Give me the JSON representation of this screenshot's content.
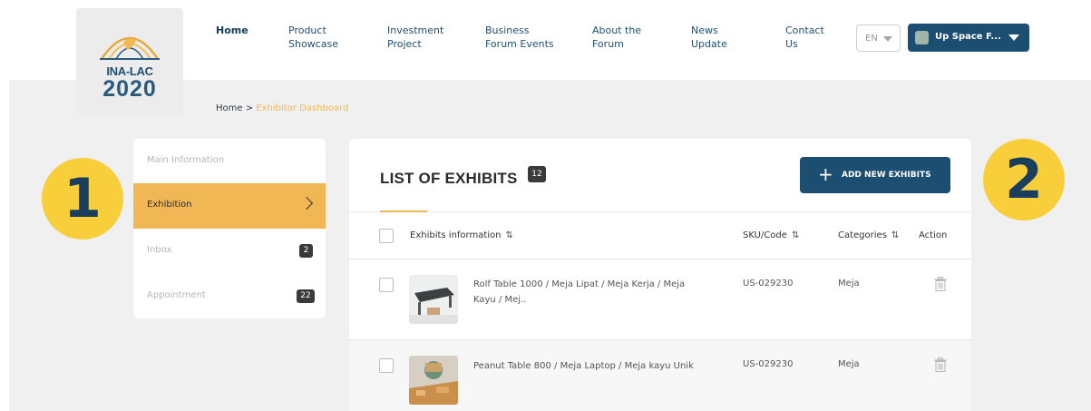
{
  "logo": {
    "line1": "INA-LAC",
    "line2": "2020"
  },
  "nav": [
    {
      "label": "Home",
      "active": true
    },
    {
      "label": "Product\nShowcase"
    },
    {
      "label": "Investment\nProject"
    },
    {
      "label": "Business\nForum Events"
    },
    {
      "label": "About the\nForum"
    },
    {
      "label": "News\nUpdate"
    },
    {
      "label": "Contact\nUs"
    }
  ],
  "language": {
    "selected": "EN"
  },
  "user": {
    "name": "Up Space F..."
  },
  "breadcrumb": {
    "home": "Home",
    "separator": " > ",
    "current": "Exhibitor Dashboard"
  },
  "sidebar": {
    "items": [
      {
        "label": "Main Information"
      },
      {
        "label": "Exhibition",
        "active": true
      },
      {
        "label": "Inbox",
        "badge": "2"
      },
      {
        "label": "Appointment",
        "badge": "22"
      }
    ]
  },
  "markers": {
    "left": "1",
    "right": "2"
  },
  "exhibits": {
    "title": "LIST OF EXHIBITS",
    "count": "12",
    "add_button": "ADD NEW EXHIBITS",
    "columns": {
      "info": "Exhibits information",
      "sku": "SKU/Code",
      "categories": "Categories",
      "action": "Action"
    },
    "rows": [
      {
        "name": "Rolf Table 1000 / Meja Lipat / Meja Kerja / Meja Kayu / Mej..",
        "sku": "US-029230",
        "category": "Meja"
      },
      {
        "name": "Peanut Table 800 / Meja Laptop / Meja kayu Unik",
        "sku": "US-029230",
        "category": "Meja"
      }
    ]
  },
  "colors": {
    "brand_navy": "#1c4e72",
    "accent_orange": "#f2b755",
    "marker_yellow": "#f8ce3a",
    "page_bg": "#f0f0f0"
  },
  "icons": [
    "sort-icon",
    "chevron-right-icon",
    "plus-icon",
    "trash-icon",
    "caret-down-icon"
  ]
}
